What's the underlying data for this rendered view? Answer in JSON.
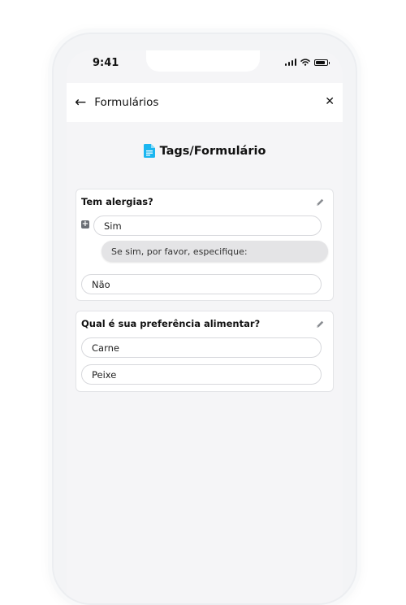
{
  "status_bar": {
    "time": "9:41"
  },
  "nav": {
    "title": "Formulários"
  },
  "header": {
    "title": "Tags/Formulário",
    "icon": "document-icon",
    "icon_color": "#1bb6f0"
  },
  "questions": [
    {
      "label": "Tem alergias?",
      "options": [
        "Sim",
        "Não"
      ],
      "sub_option": "Se sim, por favor, especifique:"
    },
    {
      "label": "Qual é sua preferência alimentar?",
      "options": [
        "Carne",
        "Peixe"
      ]
    }
  ]
}
